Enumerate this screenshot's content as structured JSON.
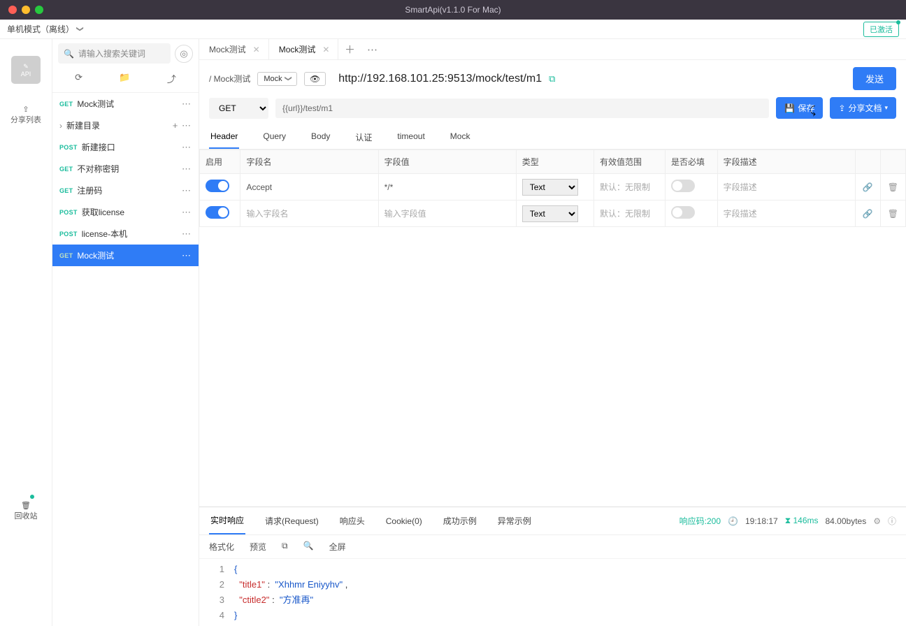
{
  "window": {
    "title": "SmartApi(v1.1.0 For Mac)"
  },
  "topbar": {
    "mode": "单机模式（离线）",
    "activated": "已激活"
  },
  "leftbar": {
    "api": "API",
    "share_list_label": "分享列表",
    "trash": "回收站"
  },
  "sidebar": {
    "search_placeholder": "请输入搜索关键词",
    "items": [
      {
        "method": "GET",
        "name": "Mock测试"
      },
      {
        "method": "",
        "name": "新建目录",
        "is_folder": true
      },
      {
        "method": "POST",
        "name": "新建接口"
      },
      {
        "method": "GET",
        "name": "不对称密钥"
      },
      {
        "method": "GET",
        "name": "注册码"
      },
      {
        "method": "POST",
        "name": "获取license"
      },
      {
        "method": "POST",
        "name": "license-本机"
      },
      {
        "method": "GET",
        "name": "Mock测试",
        "selected": true
      }
    ]
  },
  "tabs": [
    {
      "label": "Mock测试"
    },
    {
      "label": "Mock测试",
      "active": true
    }
  ],
  "request": {
    "crumb": "/  Mock测试",
    "mock_label": "Mock",
    "url": "http://192.168.101.25:9513/mock/test/m1",
    "send": "发送",
    "method": "GET",
    "path": "{{url}}/test/m1",
    "save": "保存",
    "share": "分享文档"
  },
  "header_tabs": [
    "Header",
    "Query",
    "Body",
    "认证",
    "timeout",
    "Mock"
  ],
  "header_table": {
    "cols": [
      "启用",
      "字段名",
      "字段值",
      "类型",
      "有效值范围",
      "是否必填",
      "字段描述"
    ],
    "rows": [
      {
        "enabled": true,
        "name": "Accept",
        "value": "*/*",
        "type": "Text",
        "range": "默认：无限制",
        "required": false,
        "desc": "字段描述"
      },
      {
        "enabled": true,
        "name": "",
        "name_placeholder": "输入字段名",
        "value": "",
        "value_placeholder": "输入字段值",
        "type": "Text",
        "range": "默认：无限制",
        "required": false,
        "desc": "字段描述"
      }
    ]
  },
  "response_tabs": [
    "实时响应",
    "请求(Request)",
    "响应头",
    "Cookie(0)",
    "成功示例",
    "异常示例"
  ],
  "response_meta": {
    "code_label": "响应码:",
    "code": "200",
    "time": "19:18:17",
    "elapsed": "146ms",
    "size": "84.00bytes"
  },
  "response_tools": [
    "格式化",
    "预览",
    "⧉",
    "🔍",
    "全屏"
  ],
  "response_body": {
    "lines": [
      "1",
      "2",
      "3",
      "4"
    ],
    "key1": "\"title1\"",
    "val1": "\"Xhhmr Eniyyhv\"",
    "key2": "\"ctitle2\"",
    "val2": "\"方准再\""
  }
}
